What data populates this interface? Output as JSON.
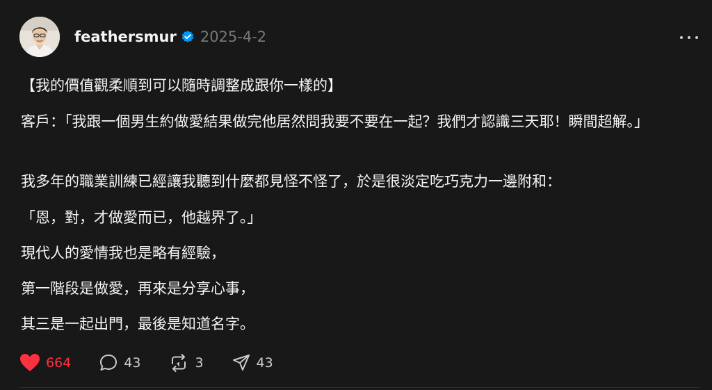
{
  "post": {
    "username": "feathersmur",
    "date": "2025-4-2",
    "verified": true,
    "paragraphs": {
      "title": "【我的價值觀柔順到可以隨時調整成跟你一樣的】",
      "client": "客戶：「我跟一個男生約做愛結果做完他居然問我要不要在一起？我們才認識三天耶！瞬間超解。」",
      "career": "我多年的職業訓練已經讓我聽到什麼都見怪不怪了，於是很淡定吃巧克力一邊附和：",
      "quote": "「恩，對，才做愛而已，他越界了。」",
      "line1": "現代人的愛情我也是略有經驗，",
      "line2": "第一階段是做愛，再來是分享心事，",
      "line3": "其三是一起出門，最後是知道名字。"
    }
  },
  "actions": {
    "likes": "664",
    "comments": "43",
    "reposts": "3",
    "shares": "43"
  },
  "icons": {
    "verified": "verified-badge-icon",
    "more": "more-horizontal-icon",
    "like": "heart-filled-icon",
    "comment": "comment-bubble-icon",
    "repost": "repost-icon",
    "share": "send-icon"
  },
  "colors": {
    "background": "#181818",
    "text": "#f3f5f7",
    "muted": "#777777",
    "like": "#ff3040",
    "verified": "#0095f6"
  }
}
